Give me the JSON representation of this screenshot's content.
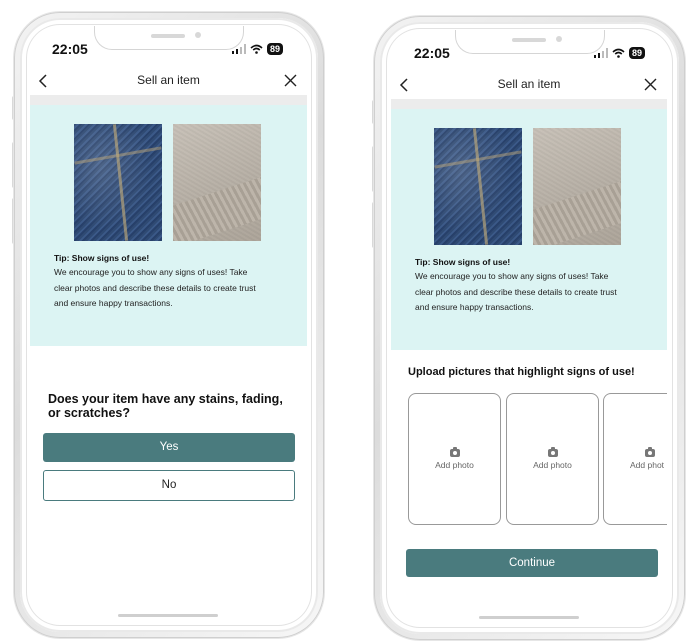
{
  "phone_left": {
    "status": {
      "time": "22:05",
      "battery": "89"
    },
    "nav": {
      "back_icon": "chevron-left-icon",
      "title": "Sell an item",
      "close_icon": "close-icon"
    },
    "tip": {
      "title": "Tip: Show signs of use!",
      "line1": "We encourage you to show any signs of uses! Take",
      "line2": "clear photos and describe these details to create trust",
      "line3": "and ensure happy transactions."
    },
    "question": {
      "line1": "Does your item have any stains, fading,",
      "line2": "or scratches?"
    },
    "yes_label": "Yes",
    "no_label": "No"
  },
  "phone_right": {
    "status": {
      "time": "22:05",
      "battery": "89"
    },
    "nav": {
      "back_icon": "chevron-left-icon",
      "title": "Sell an item",
      "close_icon": "close-icon"
    },
    "tip": {
      "title": "Tip: Show signs of use!",
      "line1": "We encourage you to show any signs of uses! Take",
      "line2": "clear photos and describe these details to create trust",
      "line3": "and ensure happy transactions."
    },
    "upload_title": "Upload pictures that highlight signs of use!",
    "slots": [
      {
        "label": "Add photo",
        "icon": "camera-icon"
      },
      {
        "label": "Add photo",
        "icon": "camera-icon"
      },
      {
        "label": "Add phot",
        "icon": "camera-icon"
      }
    ],
    "continue_label": "Continue"
  },
  "colors": {
    "accent": "#4a7b7e",
    "tip_background": "#dcf4f3"
  }
}
